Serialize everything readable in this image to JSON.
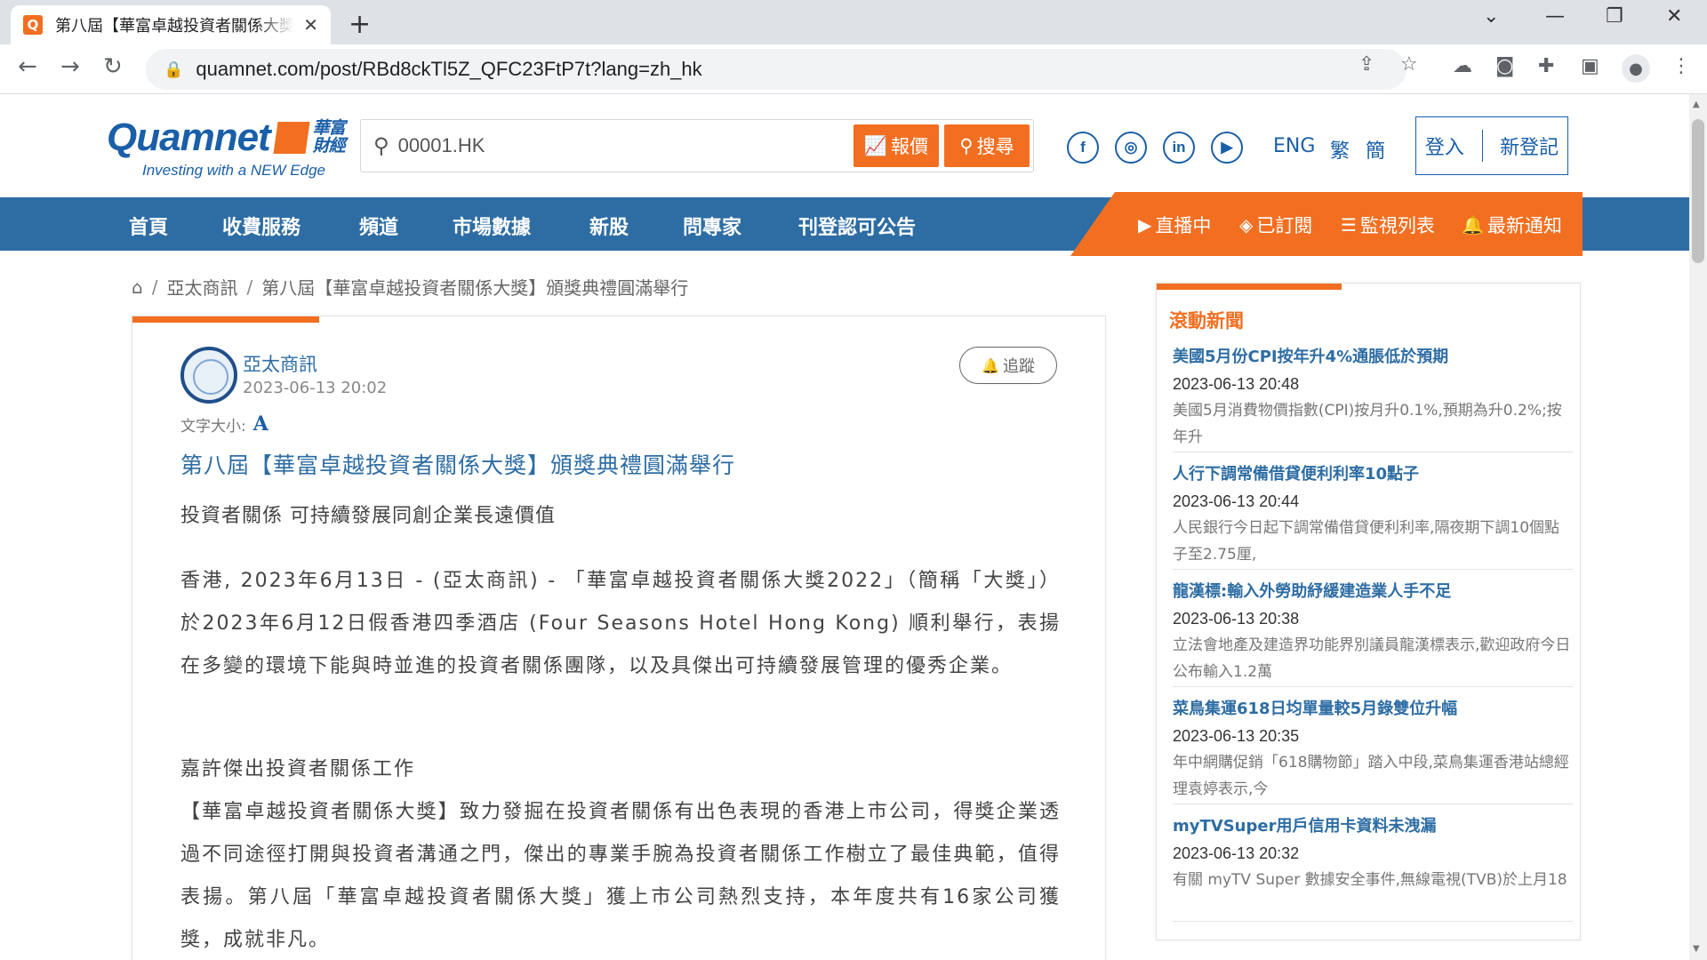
{
  "browser": {
    "tab_title": "第八屆【華富卓越投資者關係大獎】頒獎典禮圓滿舉行",
    "favicon_label": "Q",
    "url": "quamnet.com/post/RBd8ckTl5Z_QFC23FtP7t?lang=zh_hk"
  },
  "header": {
    "logo_text": "Quamnet",
    "logo_cn": "華富財經",
    "logo_tagline": "Investing with a NEW Edge",
    "search_value": "00001.HK",
    "quote_button": "報價",
    "search_button": "搜尋",
    "social": [
      "f",
      "◎",
      "in",
      "▶"
    ],
    "lang_eng": "ENG",
    "lang_trad": "繁",
    "lang_simp": "簡",
    "login": "登入",
    "register": "新登記"
  },
  "nav": {
    "items": [
      "首頁",
      "收費服務",
      "頻道",
      "市場數據",
      "新股",
      "問專家",
      "刊登認可公告"
    ],
    "live": "直播中",
    "subscribed": "已訂閱",
    "watchlist": "監視列表",
    "notifications": "最新通知"
  },
  "breadcrumb": {
    "section": "亞太商訊",
    "current": "第八屆【華富卓越投資者關係大獎】頒獎典禮圓滿舉行"
  },
  "article": {
    "author": "亞太商訊",
    "date": "2023-06-13 20:02",
    "follow": "追蹤",
    "font_size_label": "文字大小:",
    "font_size_icon": "A",
    "title": "第八屆【華富卓越投資者關係大獎】頒獎典禮圓滿舉行",
    "subtitle": "投資者關係 可持續發展同創企業長遠價值",
    "para1": "香港, 2023年6月13日 - (亞太商訊) - 「華富卓越投資者關係大獎2022」（簡稱「大獎」）於2023年6月12日假香港四季酒店 (Four Seasons Hotel Hong Kong) 順利舉行，表揚在多變的環境下能與時並進的投資者關係團隊，以及具傑出可持續發展管理的優秀企業。",
    "section_heading": "嘉許傑出投資者關係工作",
    "para2": "【華富卓越投資者關係大獎】致力發掘在投資者關係有出色表現的香港上市公司，得獎企業透過不同途徑打開與投資者溝通之門，傑出的專業手腕為投資者關係工作樹立了最佳典範，值得表揚。第八屆「華富卓越投資者關係大獎」獲上市公司熱烈支持，本年度共有16家公司獲獎，成就非凡。"
  },
  "sidebar": {
    "title": "滾動新聞",
    "news": [
      {
        "title": "美國5月份CPI按年升4%通脹低於預期",
        "time": "2023-06-13 20:48",
        "desc": "美國5月消費物價指數(CPI)按月升0.1%,預期為升0.2%;按年升"
      },
      {
        "title": "人行下調常備借貸便利利率10點子",
        "time": "2023-06-13 20:44",
        "desc": "人民銀行今日起下調常備借貸便利利率,隔夜期下調10個點子至2.75厘,"
      },
      {
        "title": "龍漢標:輸入外勞助紓緩建造業人手不足",
        "time": "2023-06-13 20:38",
        "desc": "立法會地產及建造界功能界別議員龍漢標表示,歡迎政府今日公布輸入1.2萬"
      },
      {
        "title": "菜鳥集運618日均單量較5月錄雙位升幅",
        "time": "2023-06-13 20:35",
        "desc": "年中網購促銷「618購物節」踏入中段,菜鳥集運香港站總經理袁婷表示,今"
      },
      {
        "title": "myTVSuper用戶信用卡資料未洩漏",
        "time": "2023-06-13 20:32",
        "desc": "有關 myTV Super 數據安全事件,無線電視(TVB)於上月18"
      }
    ]
  }
}
